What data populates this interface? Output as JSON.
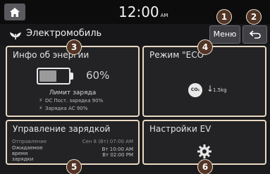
{
  "statusbar": {
    "time": "12:00",
    "ampm": "AM"
  },
  "header": {
    "title": "Электромобиль",
    "menu_label": "Меню"
  },
  "cards": {
    "charge_info": {
      "title": "Инфо об энергии",
      "battery_percent": 60,
      "battery_text": "60%",
      "limit_title": "Лимит заряда",
      "dc_limit": "DC Пост. зарядка 90%",
      "ac_limit": "Зарядка АС 90%"
    },
    "eco": {
      "title": "Режим \"ECO\"",
      "co2_label": "CO₂",
      "arrow": "↓",
      "value": "1.5kg"
    },
    "charge_mgmt": {
      "title": "Управление зарядкой",
      "departure_label": "Отправление",
      "departure_value": "Сен 8 (Вт) 07:00 AM",
      "expected_label_1": "Ожидаемое",
      "expected_label_2": "время",
      "expected_label_3": "зарядки",
      "expected_value_1": "Вт 10:00 AM",
      "expected_value_2": "Вт 02:00 PM"
    },
    "ev_settings": {
      "title": "Настройки EV"
    }
  },
  "callouts": [
    "1",
    "2",
    "3",
    "4",
    "5",
    "6"
  ],
  "colors": {
    "callout_bg": "#523526",
    "card_border": "#e8d9c2",
    "background": "#1b1b1e"
  }
}
